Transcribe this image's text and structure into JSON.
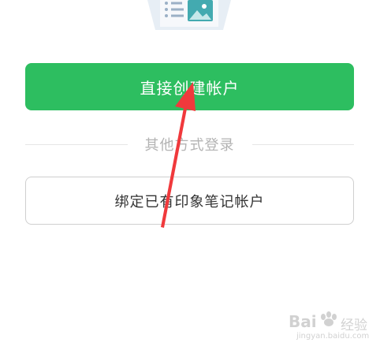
{
  "main": {
    "create_account_label": "直接创建帐户",
    "divider_text": "其他方式登录",
    "bind_account_label": "绑定已有印象笔记帐户"
  },
  "icons": {
    "illustration": "document-image-icon",
    "annotation": "red-arrow",
    "watermark": "baidu-jingyan-logo"
  },
  "colors": {
    "primary": "#2dbe60",
    "primary_text": "#ffffff",
    "divider": "#e6e6e6",
    "muted_text": "#b3b3b3",
    "border": "#cfcfcf",
    "body_text": "#333333",
    "annotation_arrow": "#f0393c"
  },
  "watermark": {
    "brand": "Bai",
    "brand_cn": "经验",
    "url": "jingyan.baidu.com"
  }
}
